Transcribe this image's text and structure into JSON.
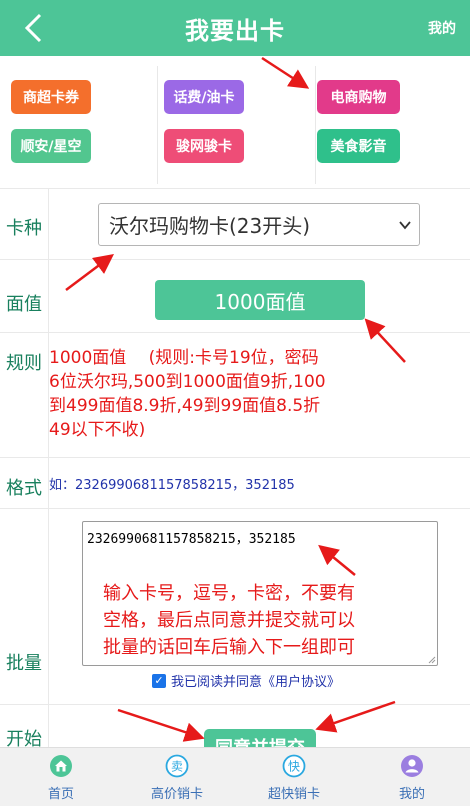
{
  "header": {
    "title": "我要出卡",
    "right_label": "我的"
  },
  "categories": [
    {
      "label": "商超卡券",
      "color": "#f46f2c"
    },
    {
      "label": "话费/油卡",
      "color": "#9b69e6"
    },
    {
      "label": "电商购物",
      "color": "#e23a8a"
    },
    {
      "label": "顺安/星空",
      "color": "#52c68f"
    },
    {
      "label": "骏网骏卡",
      "color": "#ee4d77"
    },
    {
      "label": "美食影音",
      "color": "#2fc08b"
    }
  ],
  "form": {
    "card_type_label": "卡种",
    "card_type_value": "沃尔玛购物卡(23开头)",
    "face_value_label": "面值",
    "face_value_button": "1000面值",
    "rule_label": "规则",
    "rule_text": "1000面值 　(规则:卡号19位，密码\n6位沃尔玛,500到1000面值9折,100\n到499面值8.9折,49到99面值8.5折\n49以下不收)",
    "format_label": "格式",
    "format_text": "如：2326990681157858215，352185",
    "batch_label": "批量",
    "batch_value": "2326990681157858215，352185",
    "batch_hint": "输入卡号，逗号，卡密，不要有\n空格，最后点同意并提交就可以\n批量的话回车后输入下一组即可",
    "agree_prefix": "我已阅读并同意",
    "agree_link": "《用户协议》",
    "start_label": "开始",
    "submit_label": "同意并提交"
  },
  "nav": [
    {
      "label": "首页",
      "icon": "home-icon",
      "color": "#4dc597"
    },
    {
      "label": "高价销卡",
      "icon": "mai-icon",
      "color": "#2aa8e0",
      "glyph": "卖"
    },
    {
      "label": "超快销卡",
      "icon": "kuai-icon",
      "color": "#2aa8e0",
      "glyph": "快"
    },
    {
      "label": "我的",
      "icon": "user-icon",
      "color": "#9b7ee0"
    }
  ]
}
